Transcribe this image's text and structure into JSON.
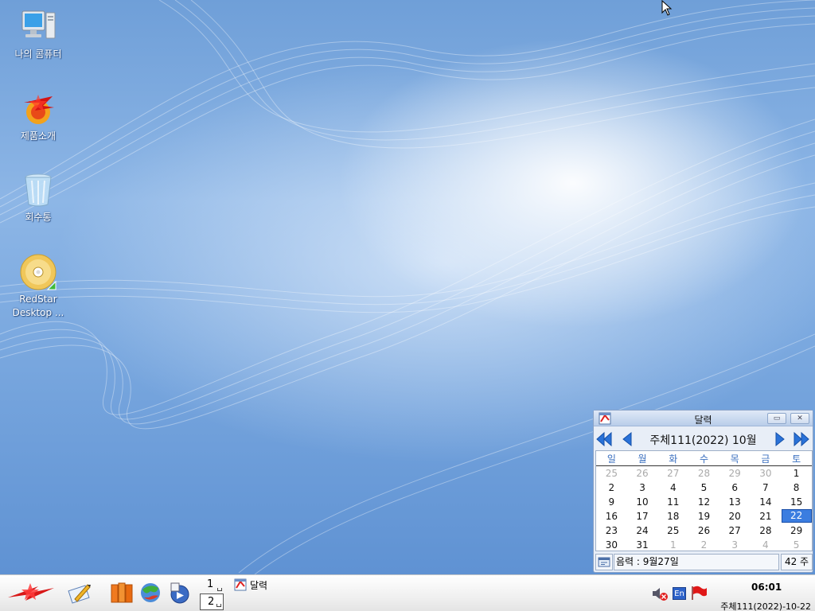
{
  "desktop": {
    "icons": [
      {
        "label": "나의 콤퓨터",
        "icon": "computer-icon"
      },
      {
        "label": "제품소개",
        "icon": "redstar-product-icon"
      },
      {
        "label": "회수통",
        "icon": "trash-icon"
      },
      {
        "label": "RedStar Desktop ...",
        "icon": "cd-icon"
      }
    ]
  },
  "calendar_window": {
    "title": "달력",
    "month_label": "주체111(2022) 10월",
    "weekday_headers": [
      "일",
      "월",
      "화",
      "수",
      "목",
      "금",
      "토"
    ],
    "weeks": [
      [
        {
          "d": "25",
          "dim": true
        },
        {
          "d": "26",
          "dim": true
        },
        {
          "d": "27",
          "dim": true
        },
        {
          "d": "28",
          "dim": true
        },
        {
          "d": "29",
          "dim": true
        },
        {
          "d": "30",
          "dim": true
        },
        {
          "d": "1"
        }
      ],
      [
        {
          "d": "2"
        },
        {
          "d": "3"
        },
        {
          "d": "4"
        },
        {
          "d": "5"
        },
        {
          "d": "6"
        },
        {
          "d": "7"
        },
        {
          "d": "8"
        }
      ],
      [
        {
          "d": "9"
        },
        {
          "d": "10"
        },
        {
          "d": "11"
        },
        {
          "d": "12"
        },
        {
          "d": "13"
        },
        {
          "d": "14"
        },
        {
          "d": "15"
        }
      ],
      [
        {
          "d": "16"
        },
        {
          "d": "17"
        },
        {
          "d": "18"
        },
        {
          "d": "19"
        },
        {
          "d": "20"
        },
        {
          "d": "21"
        },
        {
          "d": "22",
          "sel": true
        }
      ],
      [
        {
          "d": "23"
        },
        {
          "d": "24"
        },
        {
          "d": "25"
        },
        {
          "d": "26"
        },
        {
          "d": "27"
        },
        {
          "d": "28"
        },
        {
          "d": "29"
        }
      ],
      [
        {
          "d": "30"
        },
        {
          "d": "31"
        },
        {
          "d": "1",
          "dim": true
        },
        {
          "d": "2",
          "dim": true
        },
        {
          "d": "3",
          "dim": true
        },
        {
          "d": "4",
          "dim": true
        },
        {
          "d": "5",
          "dim": true
        }
      ]
    ],
    "lunar_text": "음력 : 9월27일",
    "week_number": "42 주",
    "accent_color": "#3b7de0"
  },
  "taskbar": {
    "pager": [
      "1",
      "2"
    ],
    "active_task": "달력",
    "clock_time": "06:01",
    "clock_date": "주체111(2022)-10-22",
    "tray_icons": [
      "volume-muted-icon",
      "language-en-icon",
      "flag-icon"
    ],
    "language": "En"
  }
}
